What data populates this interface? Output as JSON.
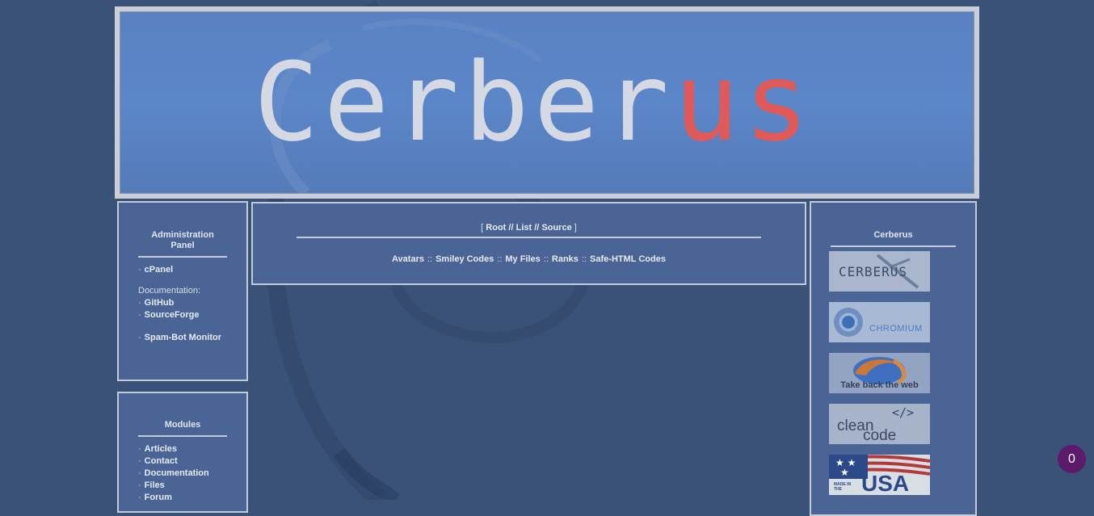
{
  "banner": {
    "title_part1": "Cerber",
    "title_part2": "us"
  },
  "left_panel_admin": {
    "title": "Administration Panel",
    "items": [
      {
        "bullet": "·",
        "label": "cPanel"
      }
    ],
    "doc_label": "Documentation:",
    "doc_items": [
      {
        "bullet": "·",
        "label": "GitHub"
      },
      {
        "bullet": "·",
        "label": "SourceForge"
      }
    ],
    "extra_items": [
      {
        "bullet": "·",
        "label": "Spam-Bot Monitor"
      }
    ]
  },
  "left_panel_modules": {
    "title": "Modules",
    "items": [
      {
        "bullet": "·",
        "label": "Articles"
      },
      {
        "bullet": "·",
        "label": "Contact"
      },
      {
        "bullet": "·",
        "label": "Documentation"
      },
      {
        "bullet": "·",
        "label": "Files"
      },
      {
        "bullet": "·",
        "label": "Forum"
      }
    ]
  },
  "center_panel": {
    "bracket_open": "[",
    "bracket_close": "]",
    "path_links": [
      "Root",
      "List",
      "Source"
    ],
    "path_sep": "//",
    "links": [
      "Avatars",
      "Smiley Codes",
      "My Files",
      "Ranks",
      "Safe-HTML Codes"
    ],
    "link_sep": "::"
  },
  "right_panel": {
    "title": "Cerberus",
    "badges": [
      {
        "name": "cerberus-badge",
        "text": "CERBERUS"
      },
      {
        "name": "chromium-badge",
        "text": "CHROMIUM"
      },
      {
        "name": "firefox-badge",
        "text": "Take back the web"
      },
      {
        "name": "cleancode-badge",
        "text1": "clean",
        "text2": "code",
        "tag": "</>"
      },
      {
        "name": "made-in-usa-badge",
        "text_small": "MADE IN THE",
        "text_big": "USA"
      }
    ]
  },
  "notification": {
    "count": "0"
  },
  "colors": {
    "background": "#3a5278",
    "panel": "#4a6595",
    "accent_red": "#e05a5a",
    "counter": "#5e1a6a"
  }
}
